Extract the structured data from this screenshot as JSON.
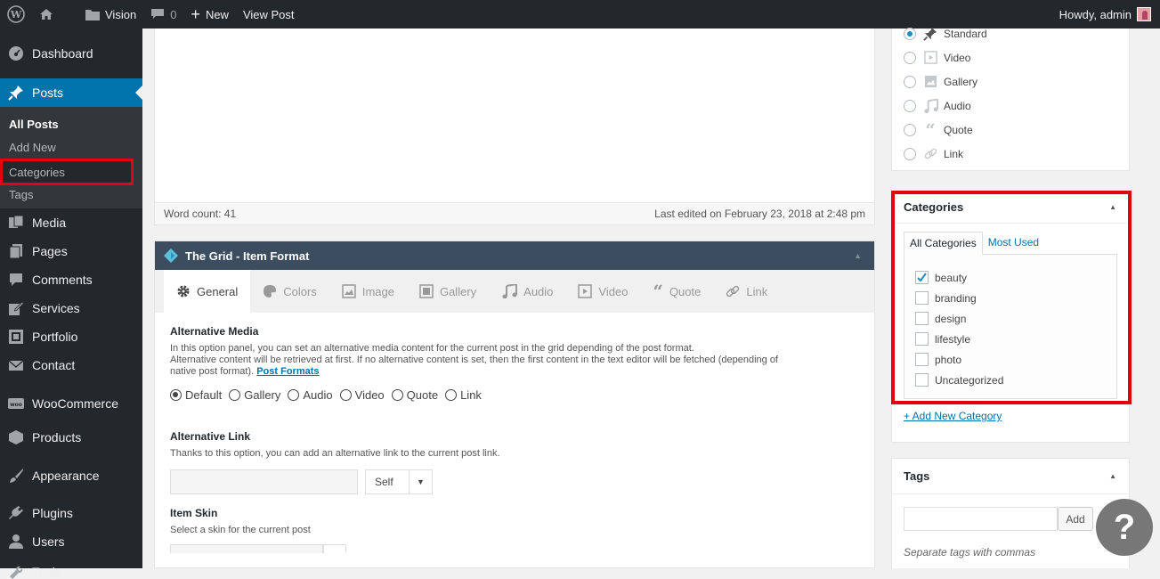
{
  "adminbar": {
    "site_name": "Vision",
    "comments_count": "0",
    "new_label": "New",
    "view_post_label": "View Post",
    "howdy": "Howdy, admin"
  },
  "sidebar": {
    "dashboard": "Dashboard",
    "posts": "Posts",
    "sub": [
      "All Posts",
      "Add New",
      "Categories",
      "Tags"
    ],
    "media": "Media",
    "pages": "Pages",
    "comments": "Comments",
    "services": "Services",
    "portfolio": "Portfolio",
    "contact": "Contact",
    "woocommerce": "WooCommerce",
    "products": "Products",
    "appearance": "Appearance",
    "plugins": "Plugins",
    "users": "Users",
    "tools": "Tools"
  },
  "editor": {
    "word_count": "Word count: 41",
    "last_edited": "Last edited on February 23, 2018 at 2:48 pm"
  },
  "grid": {
    "title": "The Grid - Item Format",
    "tabs": [
      "General",
      "Colors",
      "Image",
      "Gallery",
      "Audio",
      "Video",
      "Quote",
      "Link"
    ],
    "alt_media_title": "Alternative Media",
    "alt_media_desc1": "In this option panel, you can set an alternative media content for the current post in the grid depending of the post format.",
    "alt_media_desc2": "Alternative content will be retrieved at first. If no alternative content is set, then the first content in the text editor will be fetched (depending of",
    "alt_media_desc3": "native post format).",
    "post_formats_link": "Post Formats",
    "radios": [
      "Default",
      "Gallery",
      "Audio",
      "Video",
      "Quote",
      "Link"
    ],
    "alt_link_title": "Alternative Link",
    "alt_link_desc": "Thanks to this option, you can add an alternative link to the current post link.",
    "self_value": "Self",
    "item_skin_title": "Item Skin",
    "item_skin_desc": "Select a skin for the current post"
  },
  "formats": [
    "Standard",
    "Video",
    "Gallery",
    "Audio",
    "Quote",
    "Link"
  ],
  "categories": {
    "title": "Categories",
    "tab_all": "All Categories",
    "tab_most": "Most Used",
    "items": [
      "beauty",
      "branding",
      "design",
      "lifestyle",
      "photo",
      "Uncategorized"
    ],
    "checked": [
      true,
      false,
      false,
      false,
      false,
      false
    ],
    "add_new": "+ Add New Category"
  },
  "tags": {
    "title": "Tags",
    "add_label": "Add",
    "hint": "Separate tags with commas"
  },
  "help": {
    "symbol": "?"
  },
  "colors": {
    "highlight": "#e3000f",
    "wp_blue": "#0073aa",
    "grid_header": "#3b4d5f"
  }
}
